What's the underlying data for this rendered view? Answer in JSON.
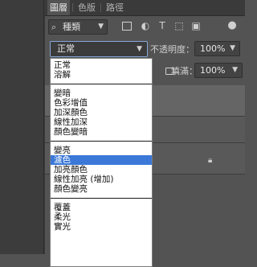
{
  "tabs": [
    "圖層",
    "色版",
    "路徑"
  ],
  "filter": {
    "kind_label": "種類",
    "icons": [
      "image-filter-icon",
      "adjustment-filter-icon",
      "type-filter-icon",
      "shape-filter-icon",
      "smart-object-filter-icon",
      "filter-toggle-icon"
    ]
  },
  "blend": {
    "current": "正常",
    "opacity_label": "不透明度：",
    "opacity_value": "100%",
    "fill_label": "填滿：",
    "fill_value": "100%"
  },
  "dropdown": {
    "groups": [
      [
        "正常",
        "溶解"
      ],
      [
        "變暗",
        "色彩增值",
        "加深顏色",
        "線性加深",
        "顏色變暗"
      ],
      [
        "變亮",
        "濾色",
        "加亮顏色",
        "線性加亮 (增加)",
        "顏色變亮"
      ],
      [
        "覆蓋",
        "柔光",
        "實光"
      ]
    ],
    "highlighted": "濾色"
  },
  "colors": {
    "panel_bg": "#535353",
    "highlight": "#3b78d8",
    "focus_border": "#86a6d6"
  }
}
